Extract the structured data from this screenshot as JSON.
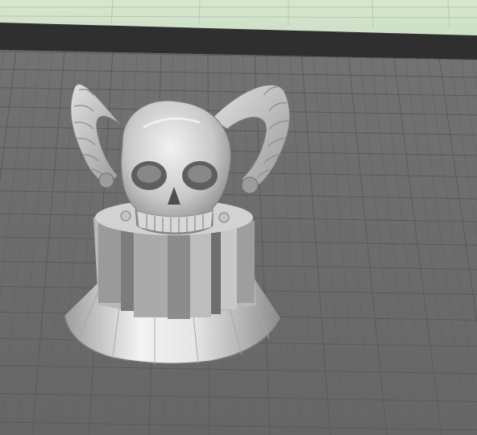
{
  "viewport": {
    "scene": "3d-build-plate",
    "background_color": "#cfe0c8",
    "plate_color": "#6b6b6b",
    "grid_color": "#5a5a5a",
    "plate_edge_color": "#2e2e2e"
  },
  "model": {
    "icon": "horned-skull-on-pedestal",
    "surface_color": "#bdbdbd"
  }
}
